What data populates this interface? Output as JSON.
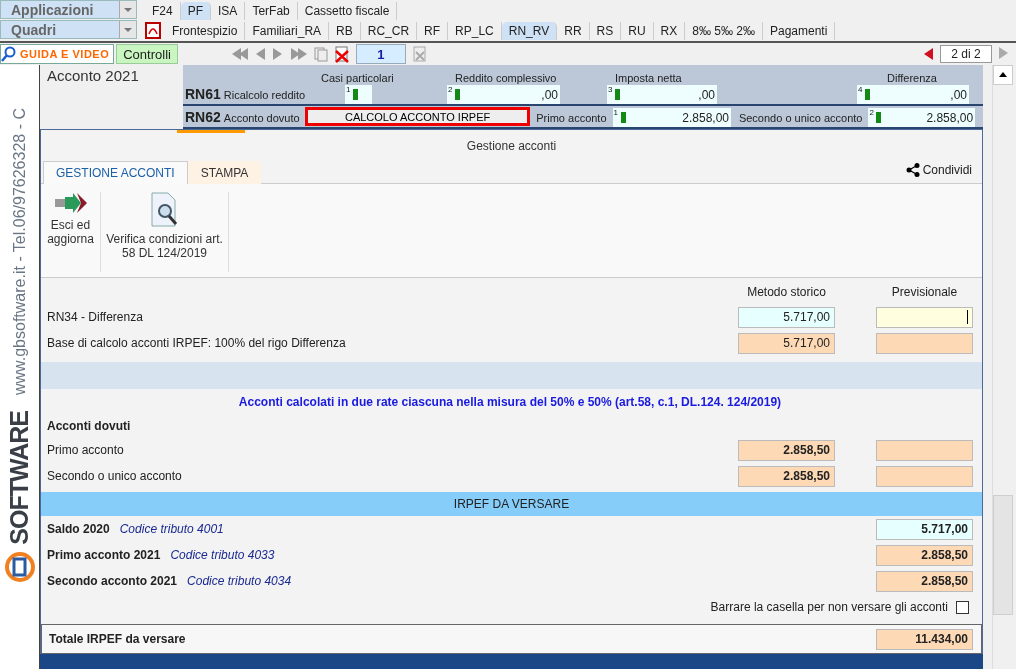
{
  "menus": [
    {
      "label": "Applicazioni"
    },
    {
      "label": "Quadri"
    }
  ],
  "app_tabs": [
    {
      "label": "F24",
      "selected": false
    },
    {
      "label": "PF",
      "selected": true
    },
    {
      "label": "ISA",
      "selected": false
    },
    {
      "label": "TerFab",
      "selected": false
    },
    {
      "label": "Cassetto fiscale",
      "selected": false
    }
  ],
  "section_tabs": [
    {
      "label": "Frontespizio",
      "selected": false
    },
    {
      "label": "Familiari_RA",
      "selected": false
    },
    {
      "label": "RB",
      "selected": false
    },
    {
      "label": "RC_CR",
      "selected": false
    },
    {
      "label": "RF",
      "selected": false
    },
    {
      "label": "RP_LC",
      "selected": false
    },
    {
      "label": "RN_RV",
      "selected": true
    },
    {
      "label": "RR",
      "selected": false
    },
    {
      "label": "RS",
      "selected": false
    },
    {
      "label": "RU",
      "selected": false
    },
    {
      "label": "RX",
      "selected": false
    },
    {
      "label": "8‰ 5‰ 2‰",
      "selected": false
    },
    {
      "label": "Pagamenti",
      "selected": false
    }
  ],
  "toolbar": {
    "guide_button": "GUIDA E VIDEO",
    "checks_button": "Controlli",
    "page_field": "1",
    "page_counter": "2 di 2"
  },
  "brand": {
    "contact": "www.gbsoftware.it - Tel.06/97626328 - C",
    "logo_text": "SOFTWARE"
  },
  "form": {
    "title": "Acconto 2021",
    "rn61": {
      "code": "RN61",
      "label": "Ricalcolo reddito",
      "fields": [
        {
          "caption": "Casi particolari",
          "index": "1"
        },
        {
          "caption": "Reddito complessivo",
          "index": "2",
          "value": ",00"
        },
        {
          "caption": "Imposta netta",
          "index": "3",
          "value": ",00"
        },
        {
          "caption": "Differenza",
          "index": "4",
          "value": ",00"
        }
      ]
    },
    "rn62": {
      "code": "RN62",
      "label": "Acconto dovuto",
      "button": "CALCOLO ACCONTO IRPEF",
      "fields": [
        {
          "caption": "Primo acconto",
          "index": "1",
          "value": "2.858,00"
        },
        {
          "caption": "Secondo o unico acconto",
          "index": "2",
          "value": "2.858,00"
        }
      ]
    }
  },
  "dialog": {
    "title": "Gestione acconti",
    "tabs": [
      {
        "label": "GESTIONE ACCONTI",
        "selected": true
      },
      {
        "label": "STAMPA",
        "selected": false
      }
    ],
    "share": "Condividi",
    "ribbon": [
      {
        "kind": "exit",
        "label": "Esci ed aggiorna"
      },
      {
        "kind": "verify",
        "label": "Verifica condizioni art. 58 DL 124/2019"
      }
    ],
    "columns": [
      "Metodo storico",
      "Previsionale"
    ],
    "base_rows": [
      {
        "label": "RN34 - Differenza",
        "cells": [
          {
            "kind": "editable",
            "value": "5.717,00"
          },
          {
            "kind": "active",
            "focused": true
          }
        ]
      },
      {
        "label": "Base di calcolo acconti IRPEF: 100% del rigo Differenza",
        "cells": [
          {
            "kind": "calculated",
            "value": "5.717,00"
          },
          {
            "kind": "calculated"
          }
        ]
      }
    ],
    "note": "Acconti calcolati in due rate ciascuna nella misura del 50% e 50% (art.58, c.1, DL.124. 124/2019)",
    "due_heading": "Acconti dovuti",
    "due_rows": [
      {
        "label": "Primo acconto",
        "cells": [
          {
            "kind": "calculated",
            "value": "2.858,50"
          },
          {
            "kind": "calculated"
          }
        ]
      },
      {
        "label": "Secondo o unico acconto",
        "cells": [
          {
            "kind": "calculated",
            "value": "2.858,50"
          },
          {
            "kind": "calculated"
          }
        ]
      }
    ],
    "pay_heading": "IRPEF DA VERSARE",
    "payments": [
      {
        "label": "Saldo 2020",
        "code": "Codice tributo 4001",
        "kind": "editable",
        "value": "5.717,00"
      },
      {
        "label": "Primo acconto 2021",
        "code": "Codice tributo 4033",
        "kind": "calculated",
        "value": "2.858,50"
      },
      {
        "label": "Secondo acconto 2021",
        "code": "Codice tributo 4034",
        "kind": "calculated",
        "value": "2.858,50"
      }
    ],
    "skip_checkbox": {
      "label": "Barrare la casella per non versare gli acconti",
      "checked": false
    },
    "total": {
      "label": "Totale IRPEF da versare",
      "value": "11.434,00"
    }
  }
}
